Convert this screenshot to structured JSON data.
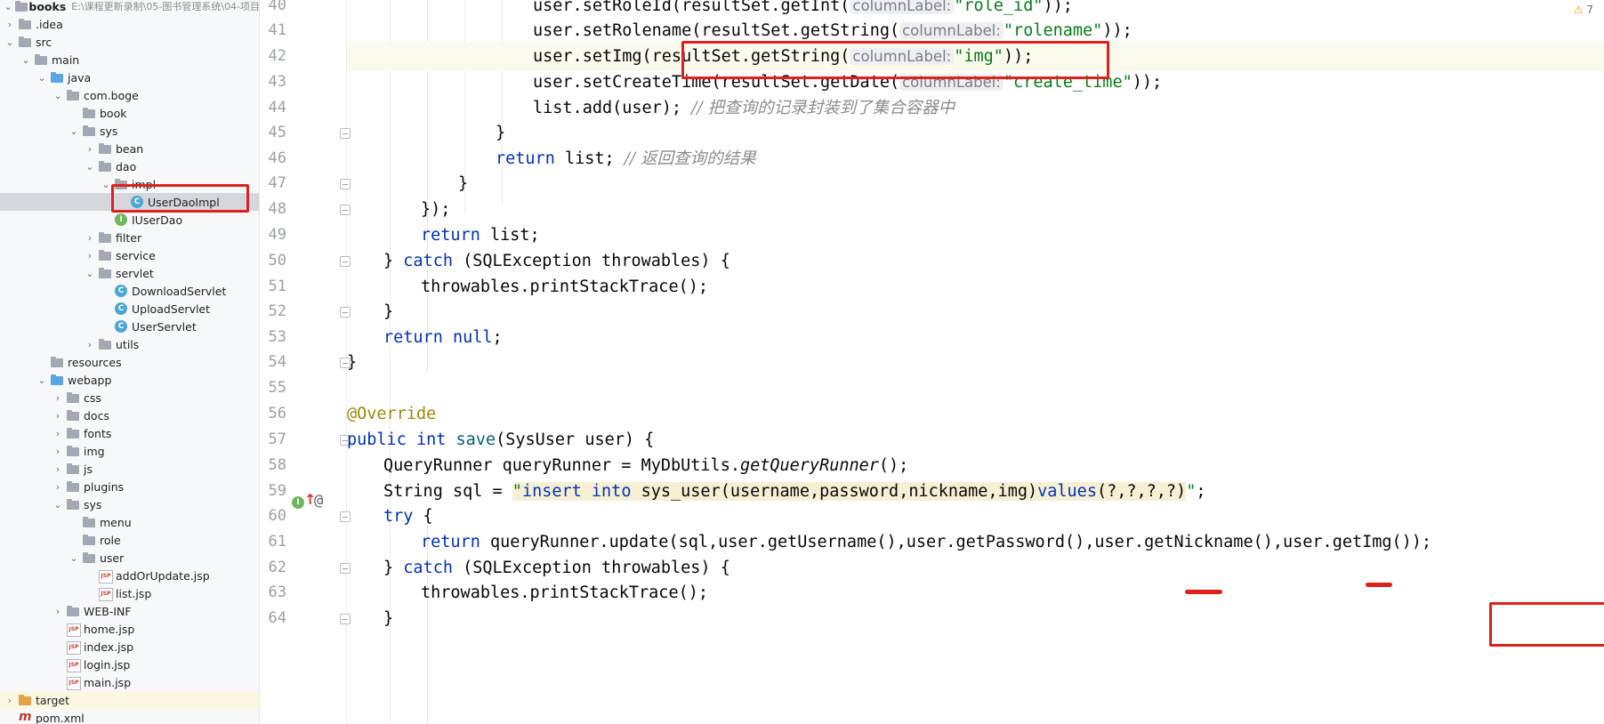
{
  "tree": {
    "root_label": "books",
    "root_path": "E:\\课程更新录制\\05-图书管理系统\\04-项目",
    "items": [
      {
        "label": "books",
        "arrow": "v",
        "icon": "folder-icon",
        "indent": 0
      },
      {
        "label": ".idea",
        "arrow": ">",
        "icon": "folder-icon",
        "indent": 0
      },
      {
        "label": "src",
        "arrow": "v",
        "icon": "folder-icon",
        "indent": 0
      },
      {
        "label": "main",
        "arrow": "v",
        "icon": "folder-icon",
        "indent": 1
      },
      {
        "label": "java",
        "arrow": "v",
        "icon": "source-folder-icon",
        "indent": 2
      },
      {
        "label": "com.boge",
        "arrow": "v",
        "icon": "package-icon",
        "indent": 3
      },
      {
        "label": "book",
        "arrow": "",
        "icon": "package-icon",
        "indent": 4
      },
      {
        "label": "sys",
        "arrow": "v",
        "icon": "package-icon",
        "indent": 4
      },
      {
        "label": "bean",
        "arrow": ">",
        "icon": "package-icon",
        "indent": 5
      },
      {
        "label": "dao",
        "arrow": "v",
        "icon": "package-icon",
        "indent": 5
      },
      {
        "label": "impl",
        "arrow": "v",
        "icon": "package-icon",
        "indent": 6
      },
      {
        "label": "UserDaoImpl",
        "arrow": "",
        "icon": "class-icon",
        "indent": 7
      },
      {
        "label": "IUserDao",
        "arrow": "",
        "icon": "interface-icon",
        "indent": 6
      },
      {
        "label": "filter",
        "arrow": ">",
        "icon": "package-icon",
        "indent": 5
      },
      {
        "label": "service",
        "arrow": ">",
        "icon": "package-icon",
        "indent": 5
      },
      {
        "label": "servlet",
        "arrow": "v",
        "icon": "package-icon",
        "indent": 5
      },
      {
        "label": "DownloadServlet",
        "arrow": "",
        "icon": "class-icon",
        "indent": 6
      },
      {
        "label": "UploadServlet",
        "arrow": "",
        "icon": "class-icon",
        "indent": 6
      },
      {
        "label": "UserServlet",
        "arrow": "",
        "icon": "class-icon",
        "indent": 6
      },
      {
        "label": "utils",
        "arrow": ">",
        "icon": "package-icon",
        "indent": 5
      },
      {
        "label": "resources",
        "arrow": "",
        "icon": "resources-folder-icon",
        "indent": 2
      },
      {
        "label": "webapp",
        "arrow": "v",
        "icon": "web-folder-icon",
        "indent": 2
      },
      {
        "label": "css",
        "arrow": ">",
        "icon": "folder-icon",
        "indent": 3
      },
      {
        "label": "docs",
        "arrow": ">",
        "icon": "folder-icon",
        "indent": 3
      },
      {
        "label": "fonts",
        "arrow": ">",
        "icon": "folder-icon",
        "indent": 3
      },
      {
        "label": "img",
        "arrow": ">",
        "icon": "folder-icon",
        "indent": 3
      },
      {
        "label": "js",
        "arrow": ">",
        "icon": "folder-icon",
        "indent": 3
      },
      {
        "label": "plugins",
        "arrow": ">",
        "icon": "folder-icon",
        "indent": 3
      },
      {
        "label": "sys",
        "arrow": "v",
        "icon": "folder-icon",
        "indent": 3
      },
      {
        "label": "menu",
        "arrow": "",
        "icon": "folder-icon",
        "indent": 4
      },
      {
        "label": "role",
        "arrow": "",
        "icon": "folder-icon",
        "indent": 4
      },
      {
        "label": "user",
        "arrow": "v",
        "icon": "folder-icon",
        "indent": 4
      },
      {
        "label": "addOrUpdate.jsp",
        "arrow": "",
        "icon": "jsp-file-icon",
        "indent": 5
      },
      {
        "label": "list.jsp",
        "arrow": "",
        "icon": "jsp-file-icon",
        "indent": 5
      },
      {
        "label": "WEB-INF",
        "arrow": ">",
        "icon": "folder-icon",
        "indent": 3
      },
      {
        "label": "home.jsp",
        "arrow": "",
        "icon": "jsp-file-icon",
        "indent": 3
      },
      {
        "label": "index.jsp",
        "arrow": "",
        "icon": "jsp-file-icon",
        "indent": 3
      },
      {
        "label": "login.jsp",
        "arrow": "",
        "icon": "jsp-file-icon",
        "indent": 3
      },
      {
        "label": "main.jsp",
        "arrow": "",
        "icon": "jsp-file-icon",
        "indent": 3
      },
      {
        "label": "target",
        "arrow": ">",
        "icon": "excluded-folder-icon",
        "indent": 0
      },
      {
        "label": "pom.xml",
        "arrow": "",
        "icon": "maven-icon",
        "indent": 0
      }
    ],
    "selected_label": "UserDaoImpl"
  },
  "editor": {
    "warning_count": "7",
    "current_line": "42",
    "lines": [
      {
        "no": "40",
        "fold": false
      },
      {
        "no": "41",
        "fold": false
      },
      {
        "no": "42",
        "fold": false
      },
      {
        "no": "43",
        "fold": false
      },
      {
        "no": "44",
        "fold": false
      },
      {
        "no": "45",
        "fold": true
      },
      {
        "no": "46",
        "fold": false
      },
      {
        "no": "47",
        "fold": true
      },
      {
        "no": "48",
        "fold": true
      },
      {
        "no": "49",
        "fold": false
      },
      {
        "no": "50",
        "fold": true
      },
      {
        "no": "51",
        "fold": false
      },
      {
        "no": "52",
        "fold": true
      },
      {
        "no": "53",
        "fold": false
      },
      {
        "no": "54",
        "fold": true
      },
      {
        "no": "55",
        "fold": false
      },
      {
        "no": "56",
        "fold": false
      },
      {
        "no": "57",
        "fold": true
      },
      {
        "no": "58",
        "fold": false
      },
      {
        "no": "59",
        "fold": false
      },
      {
        "no": "60",
        "fold": true
      },
      {
        "no": "61",
        "fold": false
      },
      {
        "no": "62",
        "fold": true
      },
      {
        "no": "63",
        "fold": false
      },
      {
        "no": "64",
        "fold": true
      }
    ],
    "code": {
      "l40_a": "user.setRoleId(resultSet.getInt(",
      "l40_hint": "columnLabel:",
      "l40_str": "\"role_id\"",
      "l40_b": "));",
      "l41_a": "user.setRolename(resultSet.getString(",
      "l41_hint": "columnLabel:",
      "l41_str": "\"rolename\"",
      "l41_b": "));",
      "l42_a": "user.setImg(resultSet.getString(",
      "l42_hint": "columnLabel:",
      "l42_str": "\"img\"",
      "l42_b": "));",
      "l43_a": "user.setCreateTime(resultSet.getDate(",
      "l43_hint": "columnLabel:",
      "l43_str": "\"create_time\"",
      "l43_b": "));",
      "l44_a": "list.add(user); ",
      "l44_cmt": "// 把查询的记录封装到了集合容器中",
      "l45": "}",
      "l46_kw": "return",
      "l46_a": " list; ",
      "l46_cmt": "// 返回查询的结果",
      "l47": "}",
      "l48": "});",
      "l49_kw": "return",
      "l49_a": " list;",
      "l50_a": "} ",
      "l50_kw": "catch",
      "l50_b": " (SQLException throwables) {",
      "l51": "throwables.printStackTrace();",
      "l52": "}",
      "l53_kw": "return",
      "l53_kw2": " null",
      "l53_b": ";",
      "l54": "}",
      "l56_ann": "@Override",
      "l57_kw": "public int",
      "l57_mth": " save",
      "l57_b": "(SysUser user) {",
      "l58_a": "QueryRunner queryRunner = MyDbUtils.",
      "l58_stat": "getQueryRunner",
      "l58_b": "();",
      "l59_a": "String sql = ",
      "l59_q1": "\"",
      "l59_sql1": "insert into",
      "l59_sql2": " sys_user(username,password,nickname,img)",
      "l59_sql3": "values",
      "l59_sql4": "(?,?,?,?)",
      "l59_q2": "\"",
      "l59_b": ";",
      "l60_kw": "try",
      "l60_b": " {",
      "l61_kw": "return",
      "l61_a": " queryRunner.update(sql,user.getUsername(),user.getPassword(),user.getNickname(),user.getImg());",
      "l62_a": "} ",
      "l62_kw": "catch",
      "l62_b": " (SQLException throwables) {",
      "l63": "throwables.printStackTrace();",
      "l64": "}"
    }
  },
  "colors": {
    "highlight_box": "#e0201c",
    "keyword": "#0033b3",
    "string": "#067d17",
    "comment": "#8c8c8c",
    "annotation": "#9e880d"
  }
}
